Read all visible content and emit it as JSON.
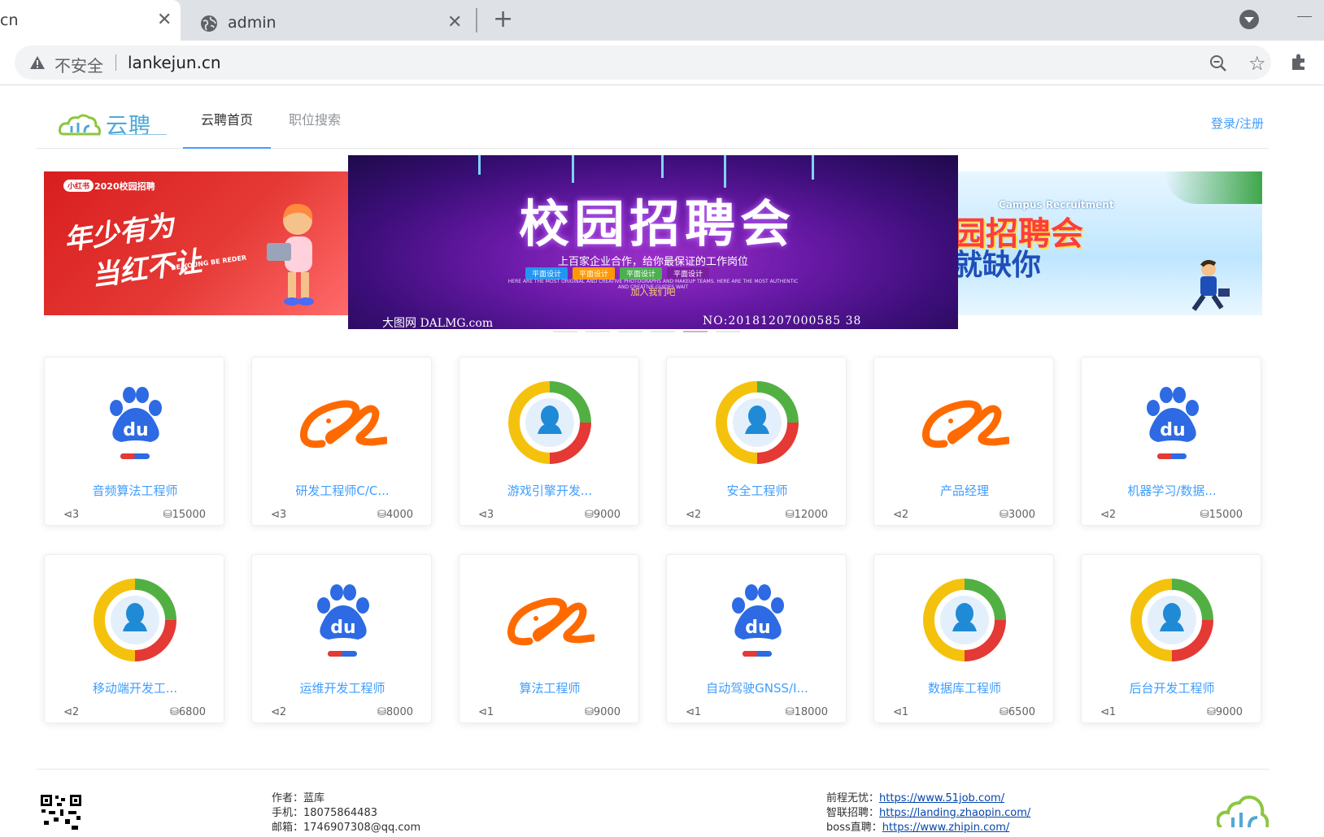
{
  "browser": {
    "tabs": [
      {
        "title": "cn"
      },
      {
        "title": "admin"
      }
    ],
    "security_label": "不安全",
    "url": "lankejun.cn"
  },
  "site": {
    "logo_text": "云聘",
    "nav": [
      {
        "label": "云聘首页",
        "active": true
      },
      {
        "label": "职位搜索",
        "active": false
      }
    ],
    "login_label": "登录/注册"
  },
  "carousel": {
    "left": {
      "badge": "小红书",
      "year": "2020校园招聘",
      "line1": "年少有为",
      "line2": "当红不让",
      "tagline": "BE YOUNG BE REDER"
    },
    "center": {
      "title": "校园招聘会",
      "subtitle": "上百家企业合作，给你最保证的工作岗位",
      "pills": [
        "平面设计",
        "平面设计",
        "平面设计",
        "平面设计"
      ],
      "fine_print": "HERE ARE THE MOST ORIGINAL AND CREATIVE PHOTOGRAPHS AND MAKEUP TEAMS. HERE ARE THE MOST AUTHENTIC AND CREATIVE GUIDES WAIT",
      "join": "加入我们吧",
      "watermark_left": "大图网 DALMG.com",
      "watermark_right": "NO:20181207000585 38"
    },
    "right": {
      "en": "Campus Recruitment",
      "line1": "园招聘会",
      "line2": "就缺你"
    },
    "indicator_count": 6,
    "active_indicator": 4
  },
  "jobs": [
    {
      "title": "音频算法工程师",
      "recruits": "3",
      "salary": "15000",
      "company_icon": "baidu-icon"
    },
    {
      "title": "研发工程师C/C...",
      "recruits": "3",
      "salary": "4000",
      "company_icon": "alibaba-icon"
    },
    {
      "title": "游戏引擎开发...",
      "recruits": "3",
      "salary": "9000",
      "company_icon": "tencent-icon"
    },
    {
      "title": "安全工程师",
      "recruits": "2",
      "salary": "12000",
      "company_icon": "tencent-icon"
    },
    {
      "title": "产品经理",
      "recruits": "2",
      "salary": "3000",
      "company_icon": "alibaba-icon"
    },
    {
      "title": "机器学习/数据...",
      "recruits": "2",
      "salary": "15000",
      "company_icon": "baidu-icon"
    },
    {
      "title": "移动端开发工...",
      "recruits": "2",
      "salary": "6800",
      "company_icon": "tencent-icon"
    },
    {
      "title": "运维开发工程师",
      "recruits": "2",
      "salary": "8000",
      "company_icon": "baidu-icon"
    },
    {
      "title": "算法工程师",
      "recruits": "1",
      "salary": "9000",
      "company_icon": "alibaba-icon"
    },
    {
      "title": "自动驾驶GNSS/I...",
      "recruits": "1",
      "salary": "18000",
      "company_icon": "baidu-icon"
    },
    {
      "title": "数据库工程师",
      "recruits": "1",
      "salary": "6500",
      "company_icon": "tencent-icon"
    },
    {
      "title": "后台开发工程师",
      "recruits": "1",
      "salary": "9000",
      "company_icon": "tencent-icon"
    }
  ],
  "footer": {
    "author": "作者：蓝库",
    "phone": "手机：18075864483",
    "email": "邮箱：1746907308@qq.com",
    "links": [
      {
        "label": "前程无忧：",
        "url": "https://www.51job.com/"
      },
      {
        "label": "智联招聘：",
        "url": "https://landing.zhaopin.com/"
      },
      {
        "label": "boss直聘：",
        "url": "https://www.zhipin.com/"
      }
    ]
  },
  "colors": {
    "accent": "#409eff",
    "logo": "#4fa9d8"
  }
}
